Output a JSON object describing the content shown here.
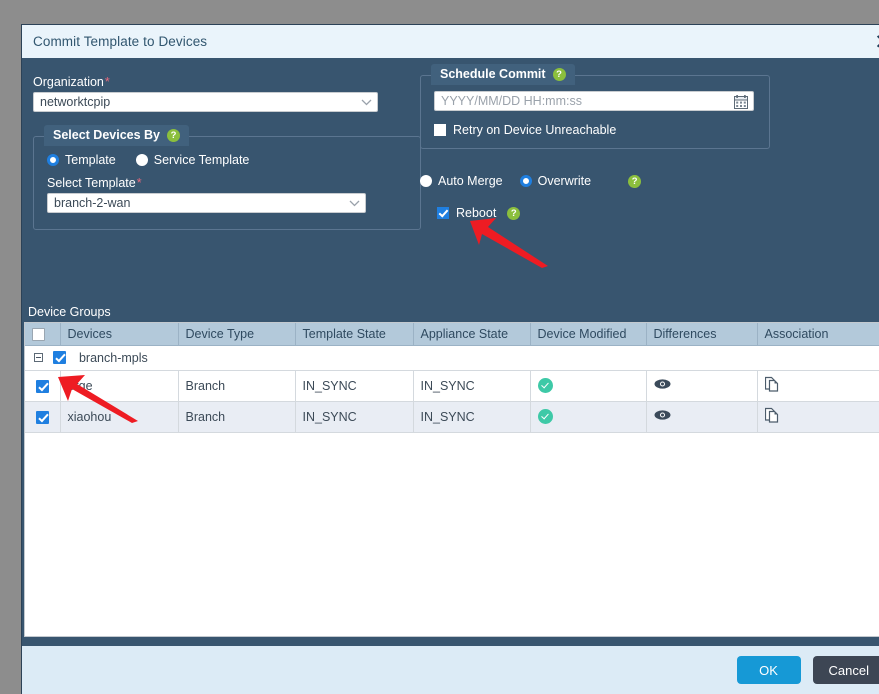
{
  "dialog": {
    "title": "Commit Template to Devices",
    "close_icon": "close-icon"
  },
  "organization": {
    "label": "Organization",
    "required_mark": "*",
    "value": "networktcpip"
  },
  "select_devices_by": {
    "legend": "Select Devices By",
    "help_icon": "help-icon",
    "options": [
      {
        "label": "Template",
        "selected": true
      },
      {
        "label": "Service Template",
        "selected": false
      }
    ],
    "template_label": "Select Template",
    "template_required_mark": "*",
    "template_value": "branch-2-wan"
  },
  "schedule_commit": {
    "legend": "Schedule Commit",
    "help_icon": "help-icon",
    "placeholder": "YYYY/MM/DD HH:mm:ss",
    "value": "",
    "calendar_icon": "calendar-icon",
    "retry_label": "Retry on Device Unreachable",
    "retry_checked": false
  },
  "merge_mode": {
    "options": [
      {
        "label": "Auto Merge",
        "selected": false
      },
      {
        "label": "Overwrite",
        "selected": true
      }
    ],
    "help_icon": "help-icon"
  },
  "reboot": {
    "label": "Reboot",
    "checked": true,
    "help_icon": "help-icon"
  },
  "device_groups": {
    "title": "Device Groups",
    "header_checkbox_checked": false,
    "columns": [
      "Devices",
      "Device Type",
      "Template State",
      "Appliance State",
      "Device Modified",
      "Differences",
      "Association"
    ],
    "group": {
      "name": "branch-mpls",
      "checked": true,
      "expanded": true,
      "expander_icon": "collapse-icon"
    },
    "rows": [
      {
        "checked": true,
        "device": "erge",
        "device_type": "Branch",
        "template_state": "IN_SYNC",
        "appliance_state": "IN_SYNC",
        "device_modified_icon": "check-circle-icon",
        "differences_icon": "eye-icon",
        "association_icon": "copy-icon"
      },
      {
        "checked": true,
        "device": "xiaohou",
        "device_type": "Branch",
        "template_state": "IN_SYNC",
        "appliance_state": "IN_SYNC",
        "device_modified_icon": "check-circle-icon",
        "differences_icon": "eye-icon",
        "association_icon": "copy-icon"
      }
    ]
  },
  "footer": {
    "ok_label": "OK",
    "cancel_label": "Cancel"
  },
  "colors": {
    "dialog_background": "#38556f",
    "titlebar_background": "#eaf4fb",
    "footer_background": "#dcebf6",
    "accent_blue": "#1f7fe0",
    "ok_button": "#1699d6",
    "cancel_button": "#3d4654",
    "help_green": "#8bbf3d",
    "status_green": "#3ec9a7",
    "required_red": "#e8697d",
    "annotation_red": "#ee1c23",
    "table_header": "#b3c9da",
    "page_background": "#8d8d8d"
  },
  "annotations": [
    {
      "name": "arrow-to-reboot",
      "points_at": "Reboot"
    },
    {
      "name": "arrow-to-row-checkbox",
      "points_at": "xiaohou row checkbox"
    }
  ]
}
